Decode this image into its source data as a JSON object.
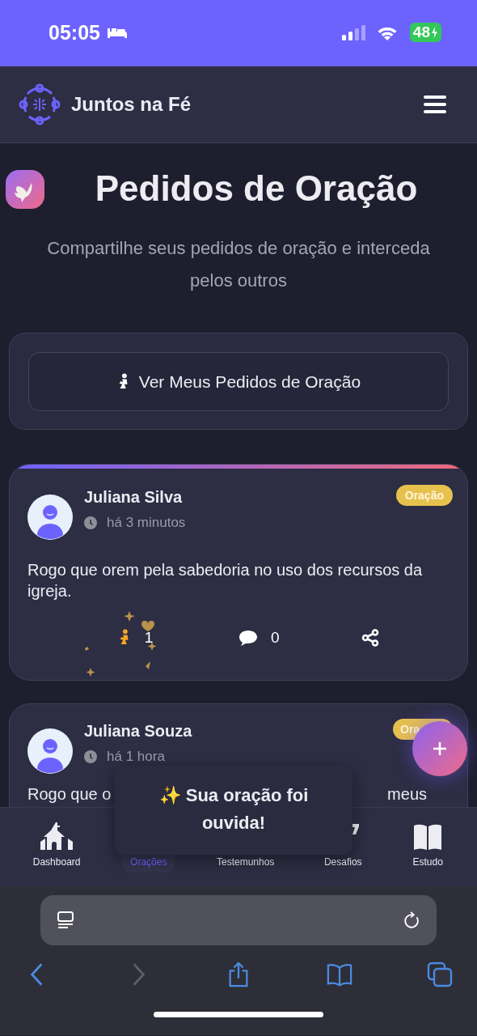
{
  "status_bar": {
    "time": "05:05",
    "battery": "48",
    "charging": true
  },
  "header": {
    "brand": "Juntos na Fé"
  },
  "page": {
    "title": "Pedidos de Oração",
    "subtitle": "Compartilhe seus pedidos de oração e interceda pelos outros"
  },
  "my_requests_button": {
    "label": "Ver Meus Pedidos de Oração"
  },
  "posts": [
    {
      "author": "Juliana Silva",
      "time": "há 3 minutos",
      "tag": "Oração",
      "text_parts": [
        "Rogo que orem pela sabedoria no uso dos recursos da igreja."
      ],
      "prayers": "1",
      "prayed": true,
      "comments": "0"
    },
    {
      "author": "Juliana Souza",
      "time": "há 1 hora",
      "tag": "Ora",
      "text_parts": [
        "Rogo que o",
        "meus"
      ]
    }
  ],
  "toast": {
    "text": "✨ Sua oração foi ouvida!"
  },
  "bottom_nav": [
    {
      "label": "Dashboard",
      "selected": false
    },
    {
      "label": "Orações",
      "selected": true
    },
    {
      "label": "Testemunhos",
      "selected": false
    },
    {
      "label": "Desafios",
      "selected": false
    },
    {
      "label": "Estudo",
      "selected": false
    }
  ]
}
